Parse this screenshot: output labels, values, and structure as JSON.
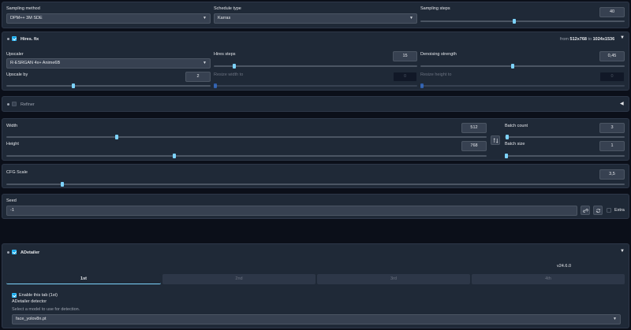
{
  "sampling": {
    "method_label": "Sampling method",
    "method_value": "DPM++ 3M SDE",
    "schedule_label": "Schedule type",
    "schedule_value": "Karras",
    "steps_label": "Sampling steps",
    "steps_value": "40",
    "steps_fraction": 0.46
  },
  "hires": {
    "title": "Hires. fix",
    "enabled": true,
    "from_label": "from",
    "from_size": "512x768",
    "to_label": "to",
    "to_size": "1024x1536",
    "upscaler_label": "Upscaler",
    "upscaler_value": "R-ESRGAN 4x+ Anime6B",
    "hires_steps_label": "Hires steps",
    "hires_steps_value": "15",
    "hires_steps_fraction": 0.1,
    "denoising_label": "Denoising strength",
    "denoising_value": "0,45",
    "denoising_fraction": 0.45,
    "upscale_by_label": "Upscale by",
    "upscale_by_value": "2",
    "upscale_by_fraction": 0.33,
    "resize_width_label": "Resize width to",
    "resize_width_value": "0",
    "resize_height_label": "Resize height to",
    "resize_height_value": "0"
  },
  "refiner": {
    "title": "Refiner",
    "enabled": false
  },
  "dimensions": {
    "width_label": "Width",
    "width_value": "512",
    "width_fraction": 0.23,
    "height_label": "Height",
    "height_value": "768",
    "height_fraction": 0.35,
    "swap_icon": "swap-arrows-icon",
    "batch_count_label": "Batch count",
    "batch_count_value": "3",
    "batch_count_fraction": 0.02,
    "batch_size_label": "Batch size",
    "batch_size_value": "1",
    "batch_size_fraction": 0.0
  },
  "cfg": {
    "label": "CFG Scale",
    "value": "3,5",
    "fraction": 0.09
  },
  "seed": {
    "label": "Seed",
    "value": "-1",
    "extra_label": "Extra",
    "dice_icon": "dice-icon",
    "recycle_icon": "recycle-icon"
  },
  "adetailer": {
    "title": "ADetailer",
    "enabled": true,
    "version": "v24.6.0",
    "tabs": [
      "1st",
      "2nd",
      "3rd",
      "4th"
    ],
    "active_tab": 0,
    "enable_tab_label": "Enable this tab (1st)",
    "detector_label": "ADetailer detector",
    "detector_hint": "Select a model to use for detection.",
    "detector_value": "face_yolov8n.pt"
  },
  "colors": {
    "accent": "#7dd3fc",
    "panel": "#1f2937",
    "background": "#0b0f19"
  }
}
